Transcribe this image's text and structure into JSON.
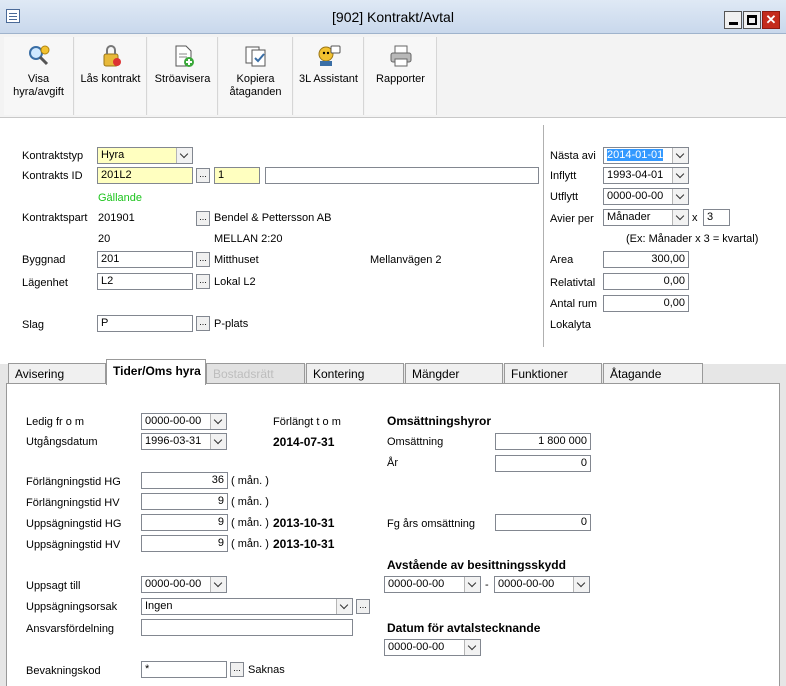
{
  "window": {
    "title": "[902]  Kontrakt/Avtal"
  },
  "toolbar": {
    "buttons": [
      {
        "label": "Visa\nhyra/avgift"
      },
      {
        "label": "Lås kontrakt"
      },
      {
        "label": "Ströavisera"
      },
      {
        "label": "Kopiera\nåtaganden"
      },
      {
        "label": "3L Assistant"
      },
      {
        "label": "Rapporter"
      }
    ]
  },
  "contract": {
    "kontraktstyp_label": "Kontraktstyp",
    "kontraktstyp_value": "Hyra",
    "kontrakts_id_label": "Kontrakts ID",
    "kontrakts_id_value": "201L2",
    "kontrakts_id_suffix": "1",
    "kontrakts_id_extra": "",
    "status": "Gällande",
    "kontraktspart_label": "Kontraktspart",
    "kontraktspart_id": "201901",
    "kontraktspart_name": "Bendel & Pettersson AB",
    "kontraktspart_sub_id": "20",
    "kontraktspart_sub_name": "MELLAN 2:20",
    "byggnad_label": "Byggnad",
    "byggnad_value": "201",
    "byggnad_name": "Mitthuset",
    "byggnad_address": "Mellanvägen 2",
    "lagenhet_label": "Lägenhet",
    "lagenhet_value": "L2",
    "lagenhet_name": "Lokal L2",
    "slag_label": "Slag",
    "slag_value": "P",
    "slag_name": "P-plats"
  },
  "side": {
    "nasta_avi_label": "Nästa avi",
    "nasta_avi_value": "2014-01-01",
    "inflytt_label": "Inflytt",
    "inflytt_value": "1993-04-01",
    "utflytt_label": "Utflytt",
    "utflytt_value": "0000-00-00",
    "avier_per_label": "Avier per",
    "avier_per_value": "Månader",
    "avier_x": "x",
    "avier_count": "3",
    "avier_hint": "(Ex: Månader x 3 = kvartal)",
    "area_label": "Area",
    "area_value": "300,00",
    "relativtal_label": "Relativtal",
    "relativtal_value": "0,00",
    "antal_rum_label": "Antal rum",
    "antal_rum_value": "0,00",
    "lokalyta_label": "Lokalyta"
  },
  "tabs": [
    {
      "label": "Avisering"
    },
    {
      "label": "Tider/Oms hyra"
    },
    {
      "label": "Bostadsrätt"
    },
    {
      "label": "Kontering"
    },
    {
      "label": "Mängder"
    },
    {
      "label": "Funktioner"
    },
    {
      "label": "Åtagande"
    }
  ],
  "tider": {
    "ledig_label": "Ledig fr o m",
    "ledig_value": "0000-00-00",
    "forlangt_label": "Förlängt t o m",
    "utgang_label": "Utgångsdatum",
    "utgang_value": "1996-03-31",
    "forlangt_value": "2014-07-31",
    "forl_hg_label": "Förlängningstid HG",
    "forl_hg_value": "36",
    "forl_hv_label": "Förlängningstid HV",
    "forl_hv_value": "9",
    "upps_hg_label": "Uppsägningstid HG",
    "upps_hg_value": "9",
    "upps_hg_date": "2013-10-31",
    "upps_hv_label": "Uppsägningstid HV",
    "upps_hv_value": "9",
    "upps_hv_date": "2013-10-31",
    "man_unit": "( mån. )",
    "uppsagt_label": "Uppsagt till",
    "uppsagt_value": "0000-00-00",
    "orsak_label": "Uppsägningsorsak",
    "orsak_value": "Ingen",
    "ansvar_label": "Ansvarsfördelning",
    "ansvar_value": "",
    "bevakning_label": "Bevakningskod",
    "bevakning_value": "*",
    "bevakning_text": "Saknas"
  },
  "oms": {
    "heading": "Omsättningshyror",
    "omsattning_label": "Omsättning",
    "omsattning_value": "1 800 000",
    "ar_label": "År",
    "ar_value": "0",
    "fg_label": "Fg års omsättning",
    "fg_value": "0",
    "avstaende_heading": "Avstående av besittningsskydd",
    "avstaende_from": "0000-00-00",
    "avstaende_dash": "-",
    "avstaende_to": "0000-00-00",
    "datum_heading": "Datum för avtalstecknande",
    "datum_value": "0000-00-00"
  }
}
